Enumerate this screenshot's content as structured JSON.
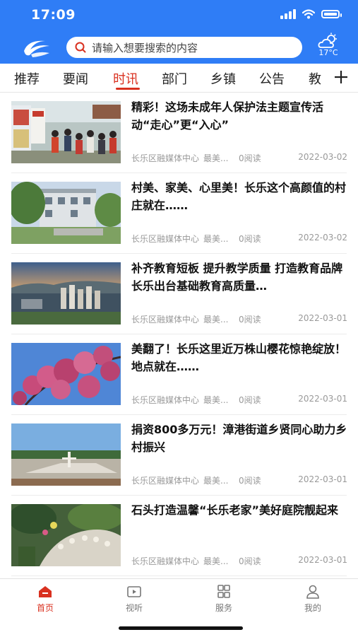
{
  "status_bar": {
    "time": "17:09"
  },
  "search": {
    "placeholder": "请输入想要搜索的内容"
  },
  "weather": {
    "temp": "17°C",
    "icon": "partly-cloudy-icon"
  },
  "tabs": [
    "推荐",
    "要闻",
    "时讯",
    "部门",
    "乡镇",
    "公告",
    "教"
  ],
  "active_tab": "时讯",
  "articles": [
    {
      "title": "精彩！这场未成年人保护法主题宣传活动“走心”更“入心”",
      "source": "长乐区融媒体中心",
      "author": "最美...",
      "reads": "0阅读",
      "date": "2022-03-02",
      "thumb": "event-photo"
    },
    {
      "title": "村美、家美、心里美！长乐这个高颜值的村庄就在……",
      "source": "长乐区融媒体中心",
      "author": "最美...",
      "reads": "0阅读",
      "date": "2022-03-02",
      "thumb": "village-photo"
    },
    {
      "title": "补齐教育短板 提升教学质量 打造教育品牌 长乐出台基础教育高质量…",
      "source": "长乐区融媒体中心",
      "author": "最美...",
      "reads": "0阅读",
      "date": "2022-03-01",
      "thumb": "city-aerial-photo"
    },
    {
      "title": "美翻了！长乐这里近万株山樱花惊艳绽放！地点就在……",
      "source": "长乐区融媒体中心",
      "author": "最美...",
      "reads": "0阅读",
      "date": "2022-03-01",
      "thumb": "cherry-blossom-photo"
    },
    {
      "title": "捐资800多万元！漳港街道乡贤同心助力乡村振兴",
      "source": "长乐区融媒体中心",
      "author": "最美...",
      "reads": "0阅读",
      "date": "2022-03-01",
      "thumb": "plaza-photo"
    },
    {
      "title": "石头打造温馨“长乐老家”美好庭院靓起来",
      "source": "长乐区融媒体中心",
      "author": "最美...",
      "reads": "0阅读",
      "date": "2022-03-01",
      "thumb": "garden-photo"
    }
  ],
  "bottom_nav": [
    {
      "label": "首页",
      "icon": "home-icon",
      "active": true
    },
    {
      "label": "视听",
      "icon": "video-icon",
      "active": false
    },
    {
      "label": "服务",
      "icon": "grid-icon",
      "active": false
    },
    {
      "label": "我的",
      "icon": "user-icon",
      "active": false
    }
  ],
  "colors": {
    "brand": "#2f7df6",
    "accent": "#d9301f"
  }
}
